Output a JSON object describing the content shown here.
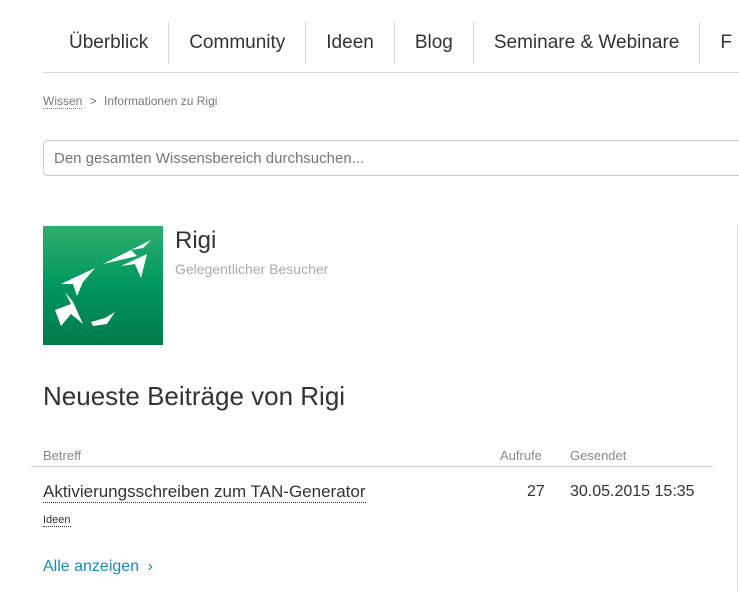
{
  "nav": {
    "items": [
      "Überblick",
      "Community",
      "Ideen",
      "Blog",
      "Seminare & Webinare",
      "F"
    ]
  },
  "breadcrumb": {
    "parent": "Wissen",
    "separator": ">",
    "current": "Informationen zu Rigi"
  },
  "search": {
    "placeholder": "Den gesamten Wissensbereich durchsuchen..."
  },
  "profile": {
    "name": "Rigi",
    "rank": "Gelegentlicher Besucher",
    "logo": "bank-logo-birds",
    "logo_color": "#00965e"
  },
  "posts": {
    "title": "Neueste Beiträge von Rigi",
    "columns": [
      "Betreff",
      "Aufrufe",
      "Gesendet"
    ],
    "rows": [
      {
        "subject": "Aktivierungsschreiben zum TAN-Generator",
        "board": "Ideen",
        "views": "27",
        "sent": "30.05.2015 15:35"
      }
    ],
    "show_all": "Alle anzeigen",
    "show_all_icon": "chevron-right-icon"
  }
}
